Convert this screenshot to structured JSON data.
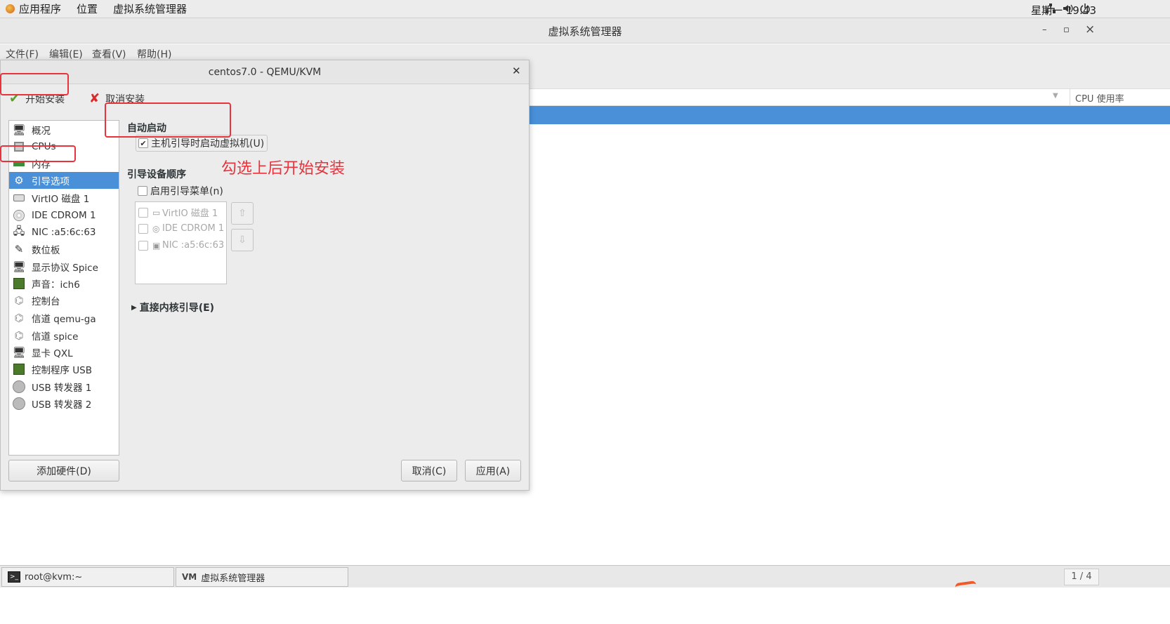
{
  "topbar": {
    "applications": "应用程序",
    "places": "位置",
    "active_app": "虚拟系统管理器",
    "clock": "星期一 19:43"
  },
  "window": {
    "title": "虚拟系统管理器",
    "minimize": "–",
    "maximize": "▫",
    "close": "×"
  },
  "menubar": {
    "file": "文件(F)",
    "edit": "编辑(E)",
    "view": "查看(V)",
    "help": "帮助(H)"
  },
  "manager_list": {
    "cpu_column": "CPU 使用率"
  },
  "dialog": {
    "title": "centos7.0 - QEMU/KVM",
    "begin_install": "开始安装",
    "cancel_install": "取消安装",
    "sidebar": [
      {
        "label": "概况",
        "icon": "monitor-icon"
      },
      {
        "label": "CPUs",
        "icon": "chip-icon"
      },
      {
        "label": "内存",
        "icon": "memory-icon"
      },
      {
        "label": "引导选项",
        "icon": "gear-icon",
        "selected": true
      },
      {
        "label": "VirtIO 磁盘 1",
        "icon": "disk-icon"
      },
      {
        "label": "IDE CDROM 1",
        "icon": "cdrom-icon"
      },
      {
        "label": "NIC :a5:6c:63",
        "icon": "network-icon"
      },
      {
        "label": "数位板",
        "icon": "tablet-icon"
      },
      {
        "label": "显示协议 Spice",
        "icon": "display-icon"
      },
      {
        "label": "声音：ich6",
        "icon": "sound-card-icon"
      },
      {
        "label": "控制台",
        "icon": "serial-icon"
      },
      {
        "label": "信道 qemu-ga",
        "icon": "channel-icon"
      },
      {
        "label": "信道 spice",
        "icon": "channel-icon"
      },
      {
        "label": "显卡 QXL",
        "icon": "video-card-icon"
      },
      {
        "label": "控制程序 USB",
        "icon": "controller-icon"
      },
      {
        "label": "USB 转发器 1",
        "icon": "usb-icon"
      },
      {
        "label": "USB 转发器 2",
        "icon": "usb-icon"
      }
    ],
    "add_hardware": "添加硬件(D)",
    "autostart_header": "自动启动",
    "autostart_checkbox": "主机引导时启动虚拟机(U)",
    "autostart_checked": true,
    "boot_order_header": "引导设备顺序",
    "boot_menu_checkbox": "启用引导菜单(n)",
    "boot_devices": [
      "VirtIO 磁盘 1",
      "IDE CDROM 1",
      "NIC :a5:6c:63"
    ],
    "direct_kernel_boot": "直接内核引导(E)",
    "cancel_button": "取消(C)",
    "apply_button": "应用(A)"
  },
  "annotation": {
    "text": "勾选上后开始安装",
    "color": "#e8323c"
  },
  "taskbar": {
    "terminal": "root@kvm:~",
    "manager": "虚拟系统管理器",
    "workspace": "1 / 4"
  },
  "colors": {
    "selection": "#4a90d9",
    "annotation": "#e8323c"
  }
}
